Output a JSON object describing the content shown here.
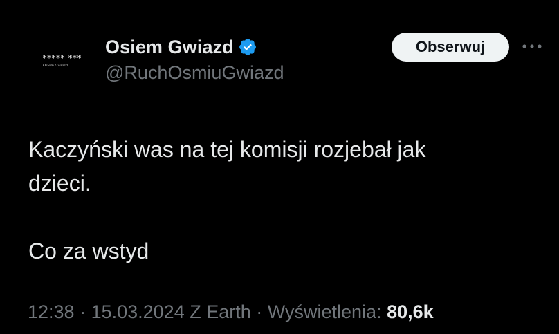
{
  "avatar": {
    "stars": "***** ***",
    "caption": "Osiem Gwiazd"
  },
  "author": {
    "display_name": "Osiem Gwiazd",
    "handle": "@RuchOsmiuGwiazd",
    "verified_icon": "verified-badge-icon",
    "verified_color": "#1d9bf0"
  },
  "actions": {
    "follow_label": "Obserwuj",
    "more_icon": "more-horizontal-icon"
  },
  "tweet": {
    "lines": [
      "Kaczyński was na tej komisji rozjebał jak",
      "dzieci.",
      "Co za wstyd"
    ]
  },
  "meta": {
    "time": "12:38",
    "sep1": " · ",
    "date": "15.03.2024",
    "source": " Z Earth",
    "sep2": " · ",
    "views_label": "Wyświetlenia: ",
    "views_count": "80,6k"
  },
  "colors": {
    "background": "#000000",
    "text_primary": "#e7e9ea",
    "text_secondary": "#71767b",
    "button_bg": "#eff3f4"
  }
}
